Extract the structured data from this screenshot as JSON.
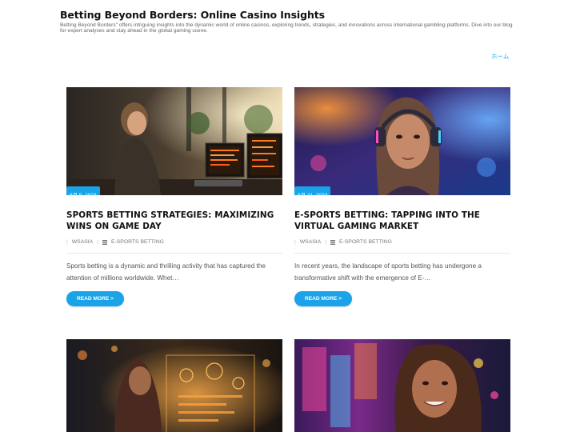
{
  "site": {
    "title": "Betting Beyond Borders: Online Casino Insights",
    "description": "Betting Beyond Borders\" offers intriguing insights into the dynamic world of online casinos, exploring trends, strategies, and innovations across international gambling platforms. Dive into our blog for expert analyses and stay ahead in the global gaming scene."
  },
  "nav": {
    "home_label": "ホーム"
  },
  "colors": {
    "accent": "#1aa3e8",
    "title": "#111111",
    "text": "#555555"
  },
  "posts": [
    {
      "date": "8月 5, 2023",
      "title": "Sports Betting Strategies: Maximizing Wins on Game Day",
      "author": "WSASIA",
      "category": "E-SPORTS BETTING",
      "excerpt": "Sports betting is a dynamic and thrilling activity that has captured the attention of millions worldwide. Whet…",
      "read_more": "READ MORE >"
    },
    {
      "date": "5月 21, 2023",
      "title": "E-Sports Betting: Tapping into the Virtual Gaming Market",
      "author": "WSASIA",
      "category": "E-SPORTS BETTING",
      "excerpt": "In recent years, the landscape of sports betting has undergone a transformative shift with the emergence of E-…",
      "read_more": "READ MORE >"
    },
    {},
    {}
  ]
}
